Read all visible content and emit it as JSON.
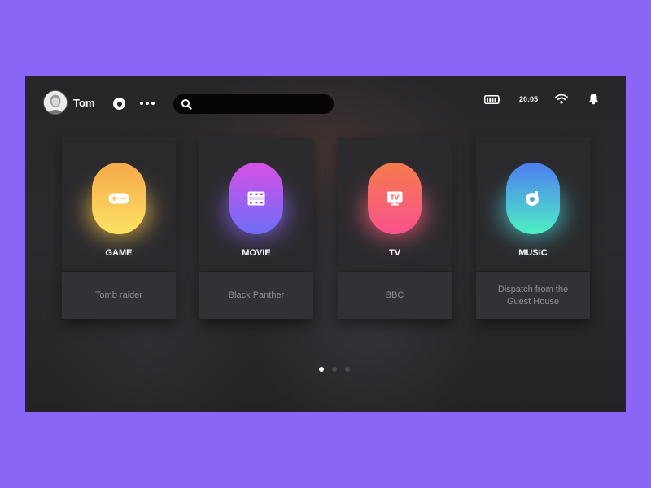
{
  "user": {
    "name": "Tom"
  },
  "search": {
    "placeholder": ""
  },
  "status": {
    "time": "20:05"
  },
  "cards": [
    {
      "label": "GAME",
      "subtitle": "Tomb raider",
      "icon": "gamepad-icon",
      "gradient": [
        "#f7a84a",
        "#fbe363"
      ],
      "glow": "#f5c24a"
    },
    {
      "label": "MOVIE",
      "subtitle": "Black Panther",
      "icon": "film-icon",
      "gradient": [
        "#d94fe6",
        "#6b6ef7"
      ],
      "glow": "#8a64f2"
    },
    {
      "label": "TV",
      "subtitle": "BBC",
      "icon": "tv-icon",
      "gradient": [
        "#f67b4c",
        "#f8528d"
      ],
      "glow": "#f65d7d"
    },
    {
      "label": "MUSIC",
      "subtitle": "Dispatch from the Guest House",
      "icon": "music-disc-icon",
      "gradient": [
        "#4d7cf1",
        "#4ef0c4"
      ],
      "glow": "#49c8d0"
    }
  ],
  "pager": {
    "count": 3,
    "active": 0
  },
  "colors": {
    "background": "#8a66f7",
    "screen": "#262628",
    "card": "#2a2a2e",
    "card_footer": "#323236"
  }
}
